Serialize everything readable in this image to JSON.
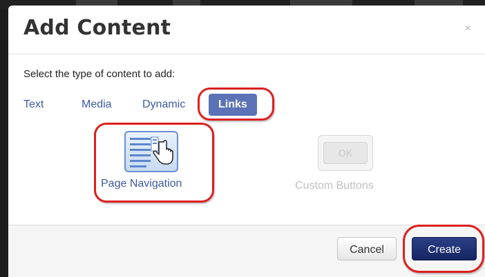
{
  "dialog": {
    "title": "Add Content",
    "close_glyph": "×",
    "prompt": "Select the type of content to add:"
  },
  "tabs": [
    {
      "label": "Text",
      "active": false
    },
    {
      "label": "Media",
      "active": false
    },
    {
      "label": "Dynamic",
      "active": false
    },
    {
      "label": "Links",
      "active": true
    }
  ],
  "content_types": [
    {
      "label": "Page Navigation",
      "icon": "page-navigation-icon",
      "enabled": true
    },
    {
      "label": "Custom Buttons",
      "icon": "ok-button-icon",
      "icon_text": "OK",
      "enabled": false
    }
  ],
  "footer": {
    "cancel_label": "Cancel",
    "create_label": "Create"
  },
  "colors": {
    "accent": "#5b72b7",
    "link": "#3c5aa0",
    "primary_button": "#1b2c6f",
    "annotation_ring": "#dc1e1e",
    "disabled_text": "#c8c8c8"
  }
}
